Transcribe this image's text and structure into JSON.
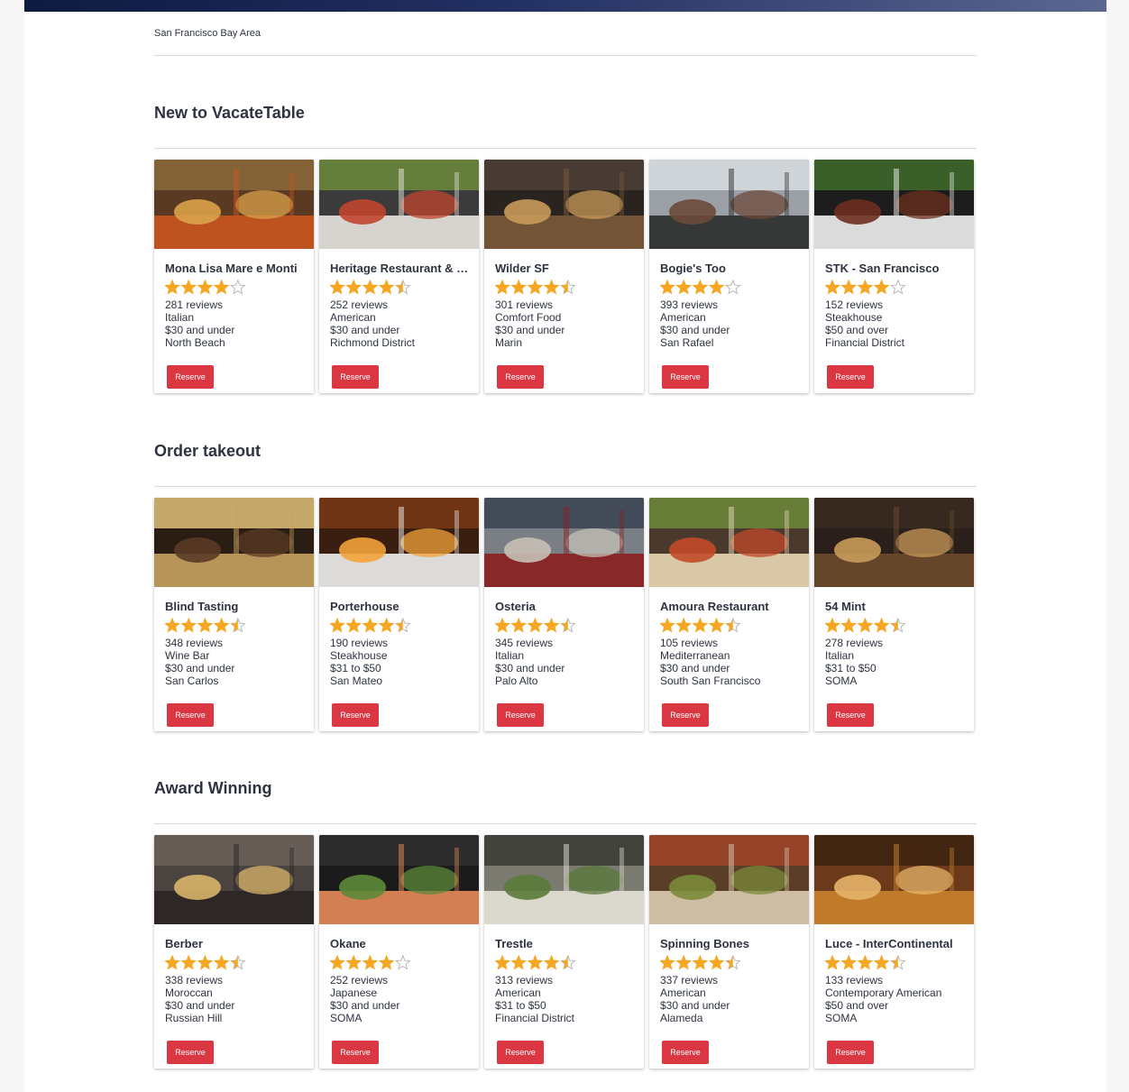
{
  "header": {
    "location": "San Francisco Bay Area"
  },
  "colors": {
    "accent": "#da3743",
    "star": "#f5a623",
    "header_dark": "#0e1a40"
  },
  "sections": [
    {
      "title": "New to VacateTable",
      "restaurants": [
        {
          "name": "Mona Lisa Mare e Monti",
          "rating": 4,
          "reviews": "281 reviews",
          "cuisine": "Italian",
          "price": "$30 and under",
          "location": "North Beach",
          "image": "mona-lisa-photo",
          "button": "Reserve"
        },
        {
          "name": "Heritage Restaurant & Bar",
          "rating": 4.5,
          "reviews": "252 reviews",
          "cuisine": "American",
          "price": "$30 and under",
          "location": "Richmond District",
          "image": "heritage-food-photo",
          "button": "Reserve"
        },
        {
          "name": "Wilder SF",
          "rating": 4.5,
          "reviews": "301 reviews",
          "cuisine": "Comfort Food",
          "price": "$30 and under",
          "location": "Marin",
          "image": "wilder-bar-photo",
          "button": "Reserve"
        },
        {
          "name": "Bogie's Too",
          "rating": 4,
          "reviews": "393 reviews",
          "cuisine": "American",
          "price": "$30 and under",
          "location": "San Rafael",
          "image": "bogies-storefront-photo",
          "button": "Reserve"
        },
        {
          "name": "STK - San Francisco",
          "rating": 4,
          "reviews": "152 reviews",
          "cuisine": "Steakhouse",
          "price": "$50 and over",
          "location": "Financial District",
          "image": "stk-steak-photo",
          "button": "Reserve"
        }
      ]
    },
    {
      "title": "Order takeout",
      "restaurants": [
        {
          "name": "Blind Tasting",
          "rating": 4.5,
          "reviews": "348 reviews",
          "cuisine": "Wine Bar",
          "price": "$30 and under",
          "location": "San Carlos",
          "image": "wine-wall-photo",
          "button": "Reserve"
        },
        {
          "name": "Porterhouse",
          "rating": 4.5,
          "reviews": "190 reviews",
          "cuisine": "Steakhouse",
          "price": "$31 to $50",
          "location": "San Mateo",
          "image": "flambe-photo",
          "button": "Reserve"
        },
        {
          "name": "Osteria",
          "rating": 4.5,
          "reviews": "345 reviews",
          "cuisine": "Italian",
          "price": "$30 and under",
          "location": "Palo Alto",
          "image": "osteria-exterior-photo",
          "button": "Reserve"
        },
        {
          "name": "Amoura Restaurant",
          "rating": 4.5,
          "reviews": "105 reviews",
          "cuisine": "Mediterranean",
          "price": "$30 and under",
          "location": "South San Francisco",
          "image": "mezze-platter-photo",
          "button": "Reserve"
        },
        {
          "name": "54 Mint",
          "rating": 4.5,
          "reviews": "278 reviews",
          "cuisine": "Italian",
          "price": "$31 to $50",
          "location": "SOMA",
          "image": "dining-room-photo",
          "button": "Reserve"
        }
      ]
    },
    {
      "title": "Award Winning",
      "restaurants": [
        {
          "name": "Berber",
          "rating": 4.5,
          "reviews": "338 reviews",
          "cuisine": "Moroccan",
          "price": "$30 and under",
          "location": "Russian Hill",
          "image": "lanterns-photo",
          "button": "Reserve"
        },
        {
          "name": "Okane",
          "rating": 4,
          "reviews": "252 reviews",
          "cuisine": "Japanese",
          "price": "$30 and under",
          "location": "SOMA",
          "image": "salmon-dish-photo",
          "button": "Reserve"
        },
        {
          "name": "Trestle",
          "rating": 4.5,
          "reviews": "313 reviews",
          "cuisine": "American",
          "price": "$31 to $50",
          "location": "Financial District",
          "image": "trestle-room-photo",
          "button": "Reserve"
        },
        {
          "name": "Spinning Bones",
          "rating": 4.5,
          "reviews": "337 reviews",
          "cuisine": "American",
          "price": "$30 and under",
          "location": "Alameda",
          "image": "shared-plates-photo",
          "button": "Reserve"
        },
        {
          "name": "Luce - InterContinental",
          "rating": 4.5,
          "reviews": "133 reviews",
          "cuisine": "Contemporary American",
          "price": "$50 and over",
          "location": "SOMA",
          "image": "luce-interior-photo",
          "button": "Reserve"
        }
      ]
    }
  ]
}
